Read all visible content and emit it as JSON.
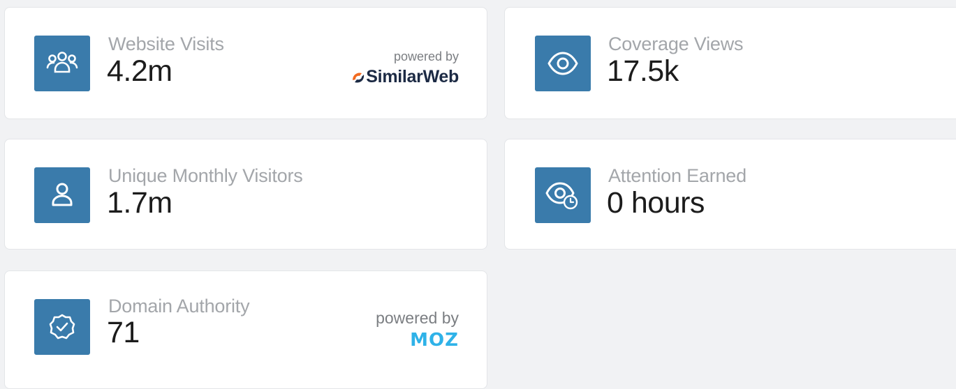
{
  "cards": [
    {
      "label": "Website Visits",
      "value": "4.2m",
      "icon": "users-group-icon",
      "powered_by": {
        "text": "powered by",
        "brand": "SimilarWeb"
      }
    },
    {
      "label": "Coverage Views",
      "value": "17.5k",
      "icon": "eye-icon"
    },
    {
      "label": "Unique Monthly Visitors",
      "value": "1.7m",
      "icon": "user-icon"
    },
    {
      "label": "Attention Earned",
      "value": "0 hours",
      "icon": "eye-clock-icon"
    },
    {
      "label": "Domain Authority",
      "value": "71",
      "icon": "badge-check-icon",
      "powered_by": {
        "text": "powered by",
        "brand": "MOZ"
      }
    }
  ],
  "colors": {
    "icon_bg": "#3a7bab",
    "label": "#a3a6aa",
    "value": "#1c1c1c",
    "moz": "#2fb2e8",
    "similarweb_dark": "#1c2a44",
    "similarweb_orange": "#f26b21",
    "background": "#f1f2f4"
  }
}
